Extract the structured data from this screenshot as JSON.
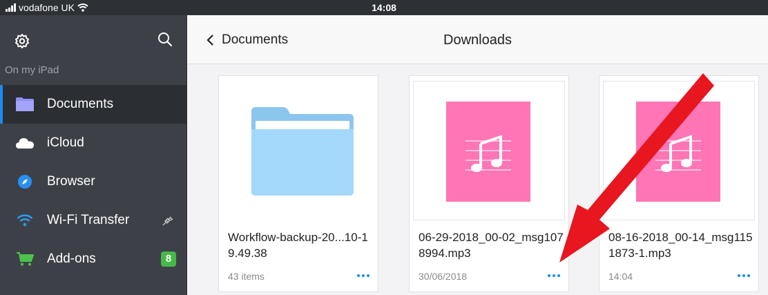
{
  "status": {
    "carrier": "vodafone UK",
    "time": "14:08"
  },
  "sidebar": {
    "section_label": "On my iPad",
    "items": [
      {
        "label": "Documents",
        "icon": "folder-icon",
        "active": true
      },
      {
        "label": "iCloud",
        "icon": "cloud-icon"
      },
      {
        "label": "Browser",
        "icon": "compass-icon"
      },
      {
        "label": "Wi-Fi Transfer",
        "icon": "wifi-icon"
      },
      {
        "label": "Add-ons",
        "icon": "cart-icon",
        "badge": "8"
      }
    ]
  },
  "header": {
    "back_label": "Documents",
    "title": "Downloads"
  },
  "files": [
    {
      "name": "Workflow-backup-20...10-19.49.38",
      "meta": "43 items",
      "type": "folder"
    },
    {
      "name": "06-29-2018_00-02_msg1078994.mp3",
      "meta": "30/06/2018",
      "type": "audio"
    },
    {
      "name": "08-16-2018_00-14_msg1151873-1.mp3",
      "meta": "14:04",
      "type": "audio"
    }
  ],
  "colors": {
    "accent": "#1a8bf0",
    "sidebar": "#3d4147",
    "audio_thumb": "#ff6fb2",
    "folder": "#9fd3f7",
    "annotation_arrow": "#e8161f"
  }
}
